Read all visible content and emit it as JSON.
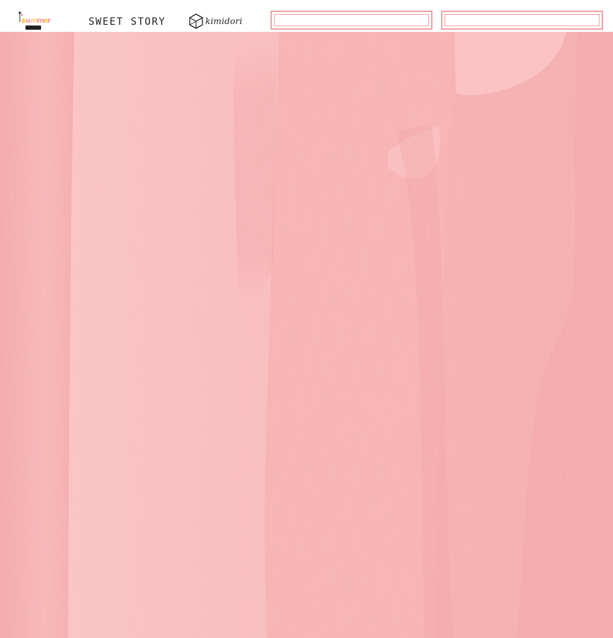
{
  "header": {
    "brand_logo": {
      "icon": "summer-brand-logo-icon",
      "text": "summer"
    },
    "collection_title": "SWEET STORY",
    "kimidori_logo": {
      "icon": "cube-logo-icon",
      "text": "kimidori"
    },
    "label_boxes": [
      "",
      ""
    ]
  },
  "paper": {
    "texture": "pink watercolor wash",
    "colors": {
      "base": "#f7b1b1",
      "light": "#fbc3c3",
      "dark": "#f2a3a6",
      "border": "#f0a3a6"
    }
  }
}
